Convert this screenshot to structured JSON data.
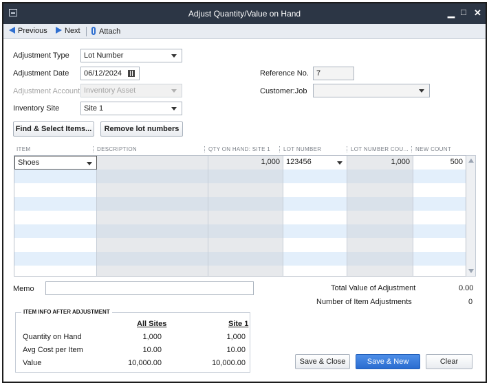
{
  "window": {
    "title": "Adjust Quantity/Value on Hand"
  },
  "toolbar": {
    "previous": "Previous",
    "next": "Next",
    "attach": "Attach"
  },
  "form": {
    "adjustment_type_label": "Adjustment Type",
    "adjustment_type_value": "Lot Number",
    "adjustment_date_label": "Adjustment Date",
    "adjustment_date_value": "06/12/2024",
    "adjustment_account_label": "Adjustment Account",
    "adjustment_account_value": "Inventory Asset",
    "inventory_site_label": "Inventory Site",
    "inventory_site_value": "Site 1",
    "reference_label": "Reference No.",
    "reference_value": "7",
    "customer_job_label": "Customer:Job",
    "customer_job_value": ""
  },
  "actions": {
    "find_select": "Find & Select Items...",
    "remove_lots": "Remove lot numbers"
  },
  "grid": {
    "columns": [
      "ITEM",
      "DESCRIPTION",
      "QTY ON HAND: SITE 1",
      "LOT NUMBER",
      "LOT NUMBER COU...",
      "NEW COUNT"
    ],
    "rows": [
      {
        "item": "Shoes",
        "description": "",
        "qty_on_hand": "1,000",
        "lot_number": "123456",
        "lot_count": "1,000",
        "new_count": "500"
      }
    ]
  },
  "memo": {
    "label": "Memo",
    "value": ""
  },
  "totals": {
    "value_label": "Total Value of Adjustment",
    "value": "0.00",
    "count_label": "Number of Item Adjustments",
    "count": "0"
  },
  "item_info": {
    "title": "ITEM INFO AFTER ADJUSTMENT",
    "col_all": "All Sites",
    "col_site": "Site 1",
    "rows": [
      {
        "label": "Quantity on Hand",
        "all": "1,000",
        "site": "1,000"
      },
      {
        "label": "Avg Cost per Item",
        "all": "10.00",
        "site": "10.00"
      },
      {
        "label": "Value",
        "all": "10,000.00",
        "site": "10,000.00"
      }
    ]
  },
  "buttons": {
    "save_close": "Save & Close",
    "save_new": "Save & New",
    "clear": "Clear"
  },
  "colors": {
    "titlebar": "#2c3645",
    "row_alt": "#e3effb",
    "disabled_col": "#e7e9ec",
    "primary": "#2a6cd0"
  }
}
